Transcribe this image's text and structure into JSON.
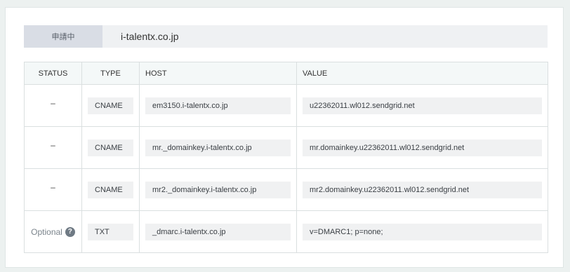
{
  "domain": {
    "status_badge": "申請中",
    "name": "i-talentx.co.jp"
  },
  "table": {
    "headers": {
      "status": "STATUS",
      "type": "TYPE",
      "host": "HOST",
      "value": "VALUE"
    },
    "rows": [
      {
        "status": "–",
        "type": "CNAME",
        "host": "em3150.i-talentx.co.jp",
        "value": "u22362011.wl012.sendgrid.net"
      },
      {
        "status": "–",
        "type": "CNAME",
        "host": "mr._domainkey.i-talentx.co.jp",
        "value": "mr.domainkey.u22362011.wl012.sendgrid.net"
      },
      {
        "status": "–",
        "type": "CNAME",
        "host": "mr2._domainkey.i-talentx.co.jp",
        "value": "mr2.domainkey.u22362011.wl012.sendgrid.net"
      },
      {
        "status": "Optional",
        "status_icon": "help-icon",
        "type": "TXT",
        "host": "_dmarc.i-talentx.co.jp",
        "value": "v=DMARC1; p=none;"
      }
    ]
  },
  "help_icon_glyph": "?",
  "colors": {
    "page_bg": "#ecf1f0",
    "card_bg": "#ffffff",
    "badge_bg": "#d9dde5",
    "field_bg": "#f0f1f2",
    "help_icon": "#6f7a84"
  }
}
